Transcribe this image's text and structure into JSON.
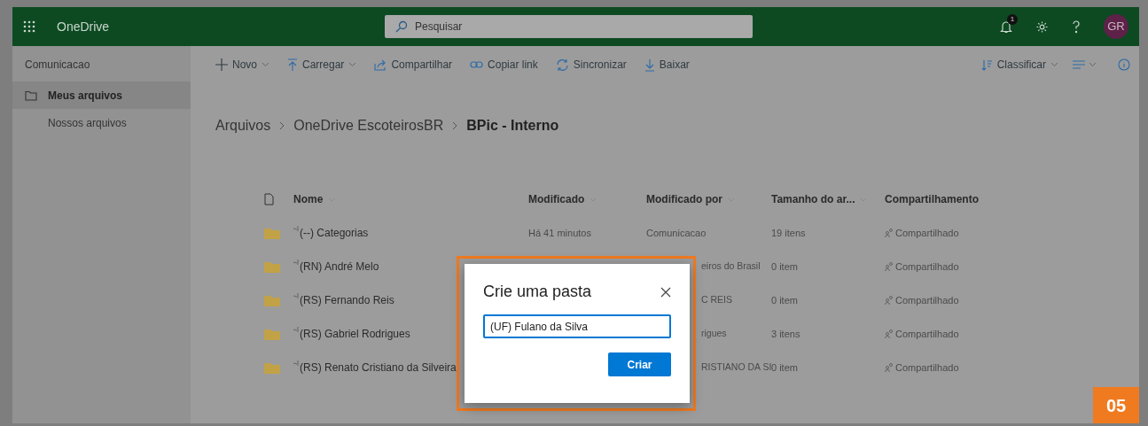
{
  "app": {
    "name": "OneDrive"
  },
  "search": {
    "placeholder": "Pesquisar"
  },
  "header": {
    "notification_count": "1",
    "avatar_initials": "GR"
  },
  "sidebar": {
    "title": "Comunicacao",
    "items": [
      {
        "label": "Meus arquivos",
        "selected": true
      },
      {
        "label": "Nossos arquivos",
        "selected": false
      }
    ]
  },
  "toolbar": {
    "commands": [
      {
        "label": "Novo",
        "dropdown": true
      },
      {
        "label": "Carregar",
        "dropdown": true
      },
      {
        "label": "Compartilhar",
        "dropdown": false
      },
      {
        "label": "Copiar link",
        "dropdown": false
      },
      {
        "label": "Sincronizar",
        "dropdown": false
      },
      {
        "label": "Baixar",
        "dropdown": false
      }
    ],
    "sort": {
      "label": "Classificar"
    }
  },
  "breadcrumb": [
    {
      "label": "Arquivos",
      "current": false
    },
    {
      "label": "OneDrive EscoteirosBR",
      "current": false
    },
    {
      "label": "BPic - Interno",
      "current": true
    }
  ],
  "table": {
    "columns": [
      "Nome",
      "Modificado",
      "Modificado por",
      "Tamanho do ar...",
      "Compartilhamento"
    ],
    "rows": [
      {
        "name": "(--) Categorias",
        "modified": "Há 41 minutos",
        "modified_by": "Comunicacao",
        "modified_by_partial": false,
        "size": "19 itens",
        "sharing": "Compartilhado"
      },
      {
        "name": "(RN) André Melo",
        "modified_by": "eiros do Brasil",
        "modified_by_partial": true,
        "size": "0 item",
        "sharing": "Compartilhado"
      },
      {
        "name": "(RS) Fernando Reis",
        "modified_by": "C REIS",
        "modified_by_partial": true,
        "size": "0 item",
        "sharing": "Compartilhado"
      },
      {
        "name": "(RS) Gabriel Rodrigues",
        "modified_by": "rigues",
        "modified_by_partial": true,
        "size": "3 itens",
        "sharing": "Compartilhado"
      },
      {
        "name": "(RS) Renato Cristiano da Silveira",
        "modified_by": "RISTIANO DA SI",
        "modified_by_partial": true,
        "size": "0 item",
        "sharing": "Compartilhado"
      }
    ]
  },
  "dialog": {
    "title": "Crie uma pasta",
    "input_value": "(UF) Fulano da Silva",
    "button": "Criar"
  },
  "step_badge": "05"
}
